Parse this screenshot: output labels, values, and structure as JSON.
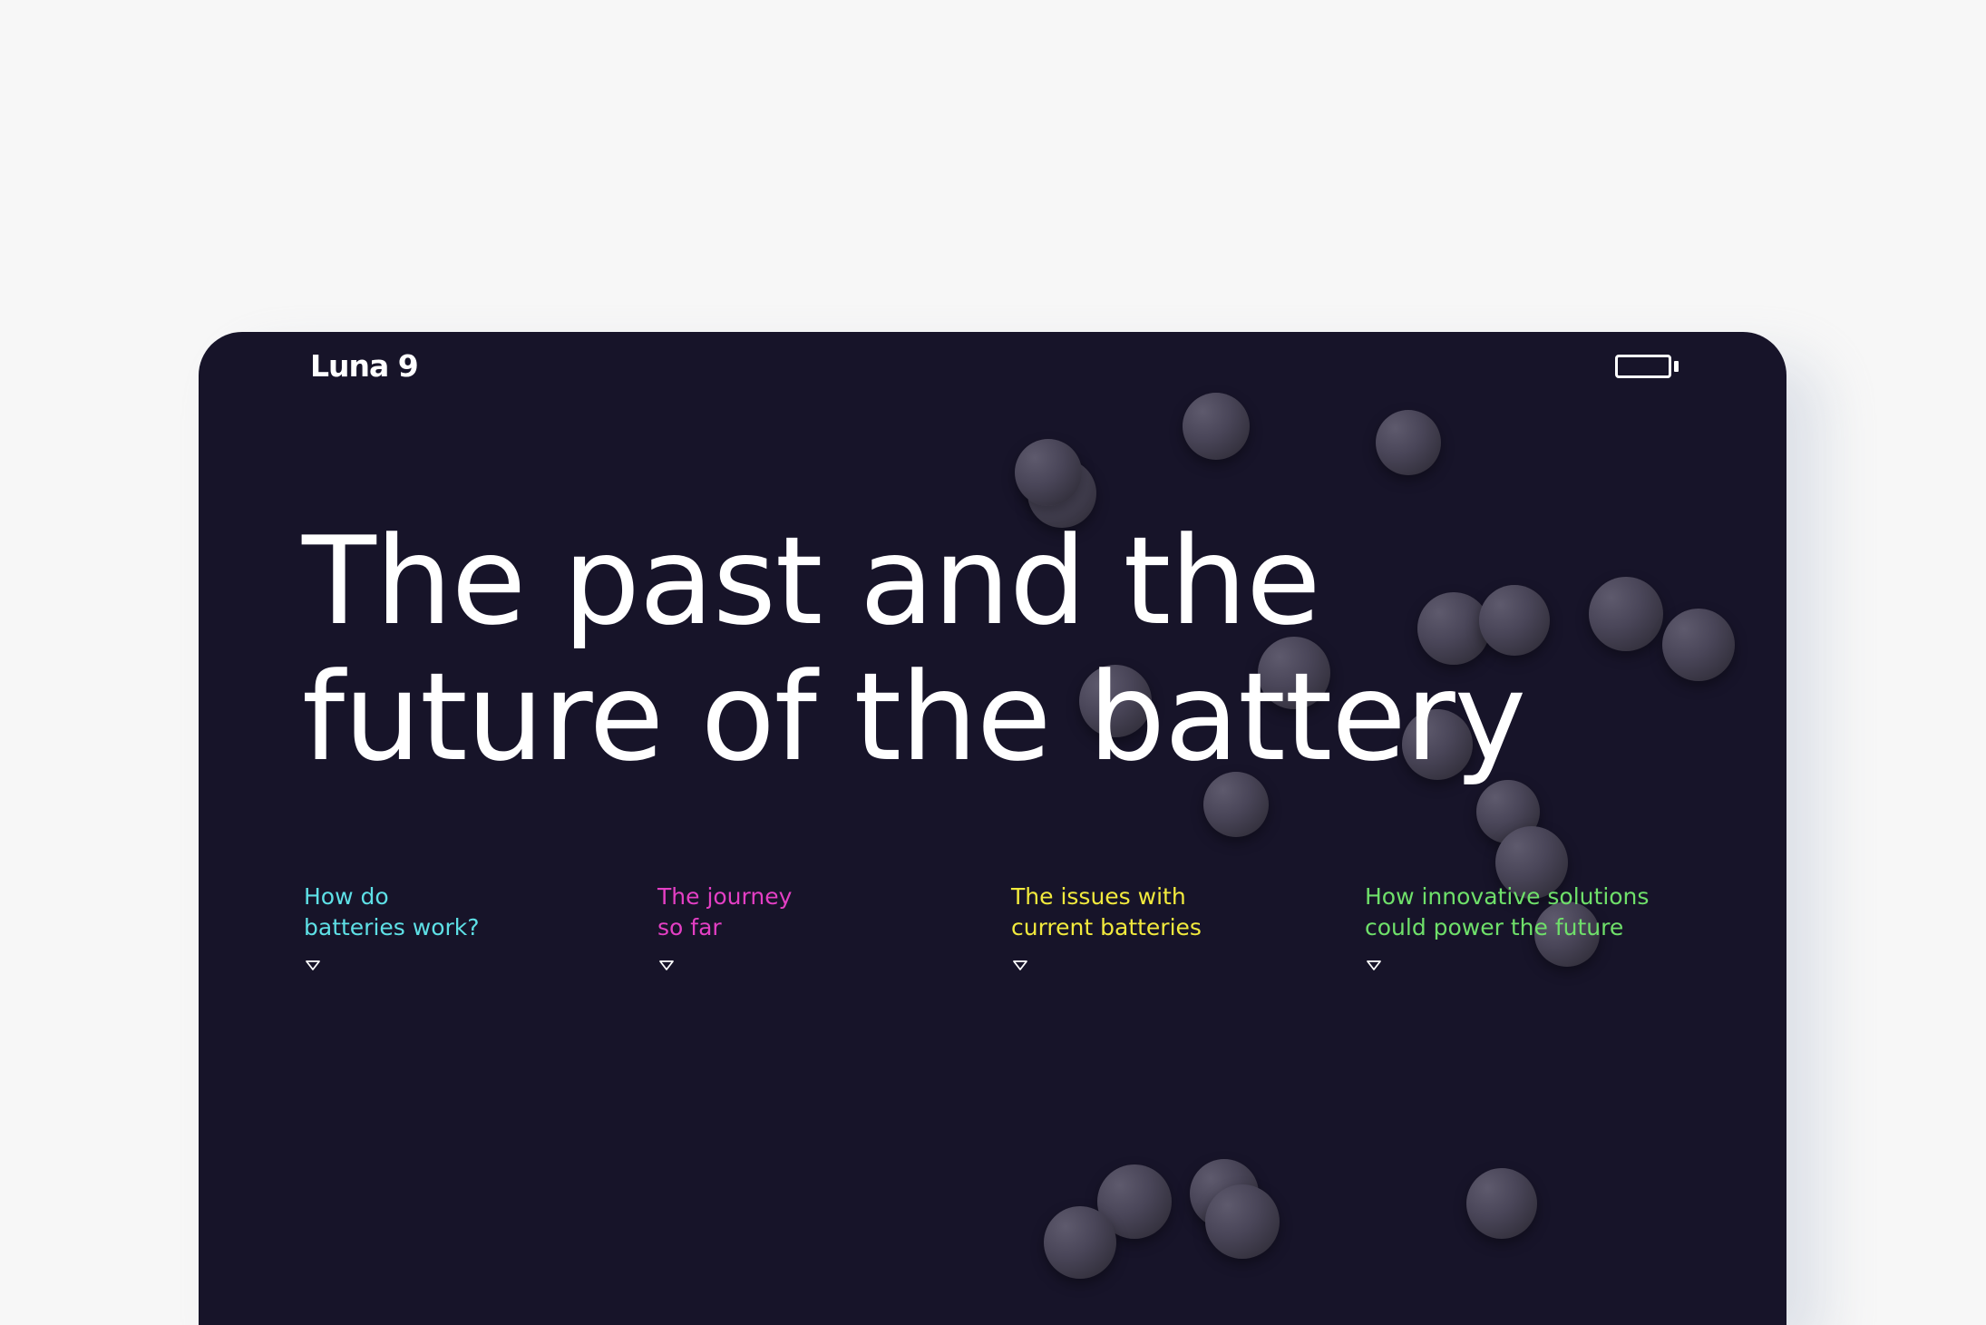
{
  "header": {
    "logo_text": "Luna 9",
    "battery_icon": "battery-icon"
  },
  "hero": {
    "headline_line1": "The past and the",
    "headline_line2": "future of the battery"
  },
  "nav": {
    "items": [
      {
        "line1": "How do",
        "line2": "batteries work?",
        "color": "#5ee0e6",
        "icon": "chevron-down-icon"
      },
      {
        "line1": "The journey",
        "line2": "so far",
        "color": "#e43fc4",
        "icon": "chevron-down-icon"
      },
      {
        "line1": "The issues with",
        "line2": "current batteries",
        "color": "#f2ea3d",
        "icon": "chevron-down-icon"
      },
      {
        "line1": "How innovative solutions",
        "line2": "could power the future",
        "color": "#6fe06a",
        "icon": "chevron-down-icon"
      }
    ]
  },
  "colors": {
    "page_background": "#f7f7f7",
    "card_background": "#171429",
    "text": "#ffffff",
    "sphere": "#4a4659"
  }
}
